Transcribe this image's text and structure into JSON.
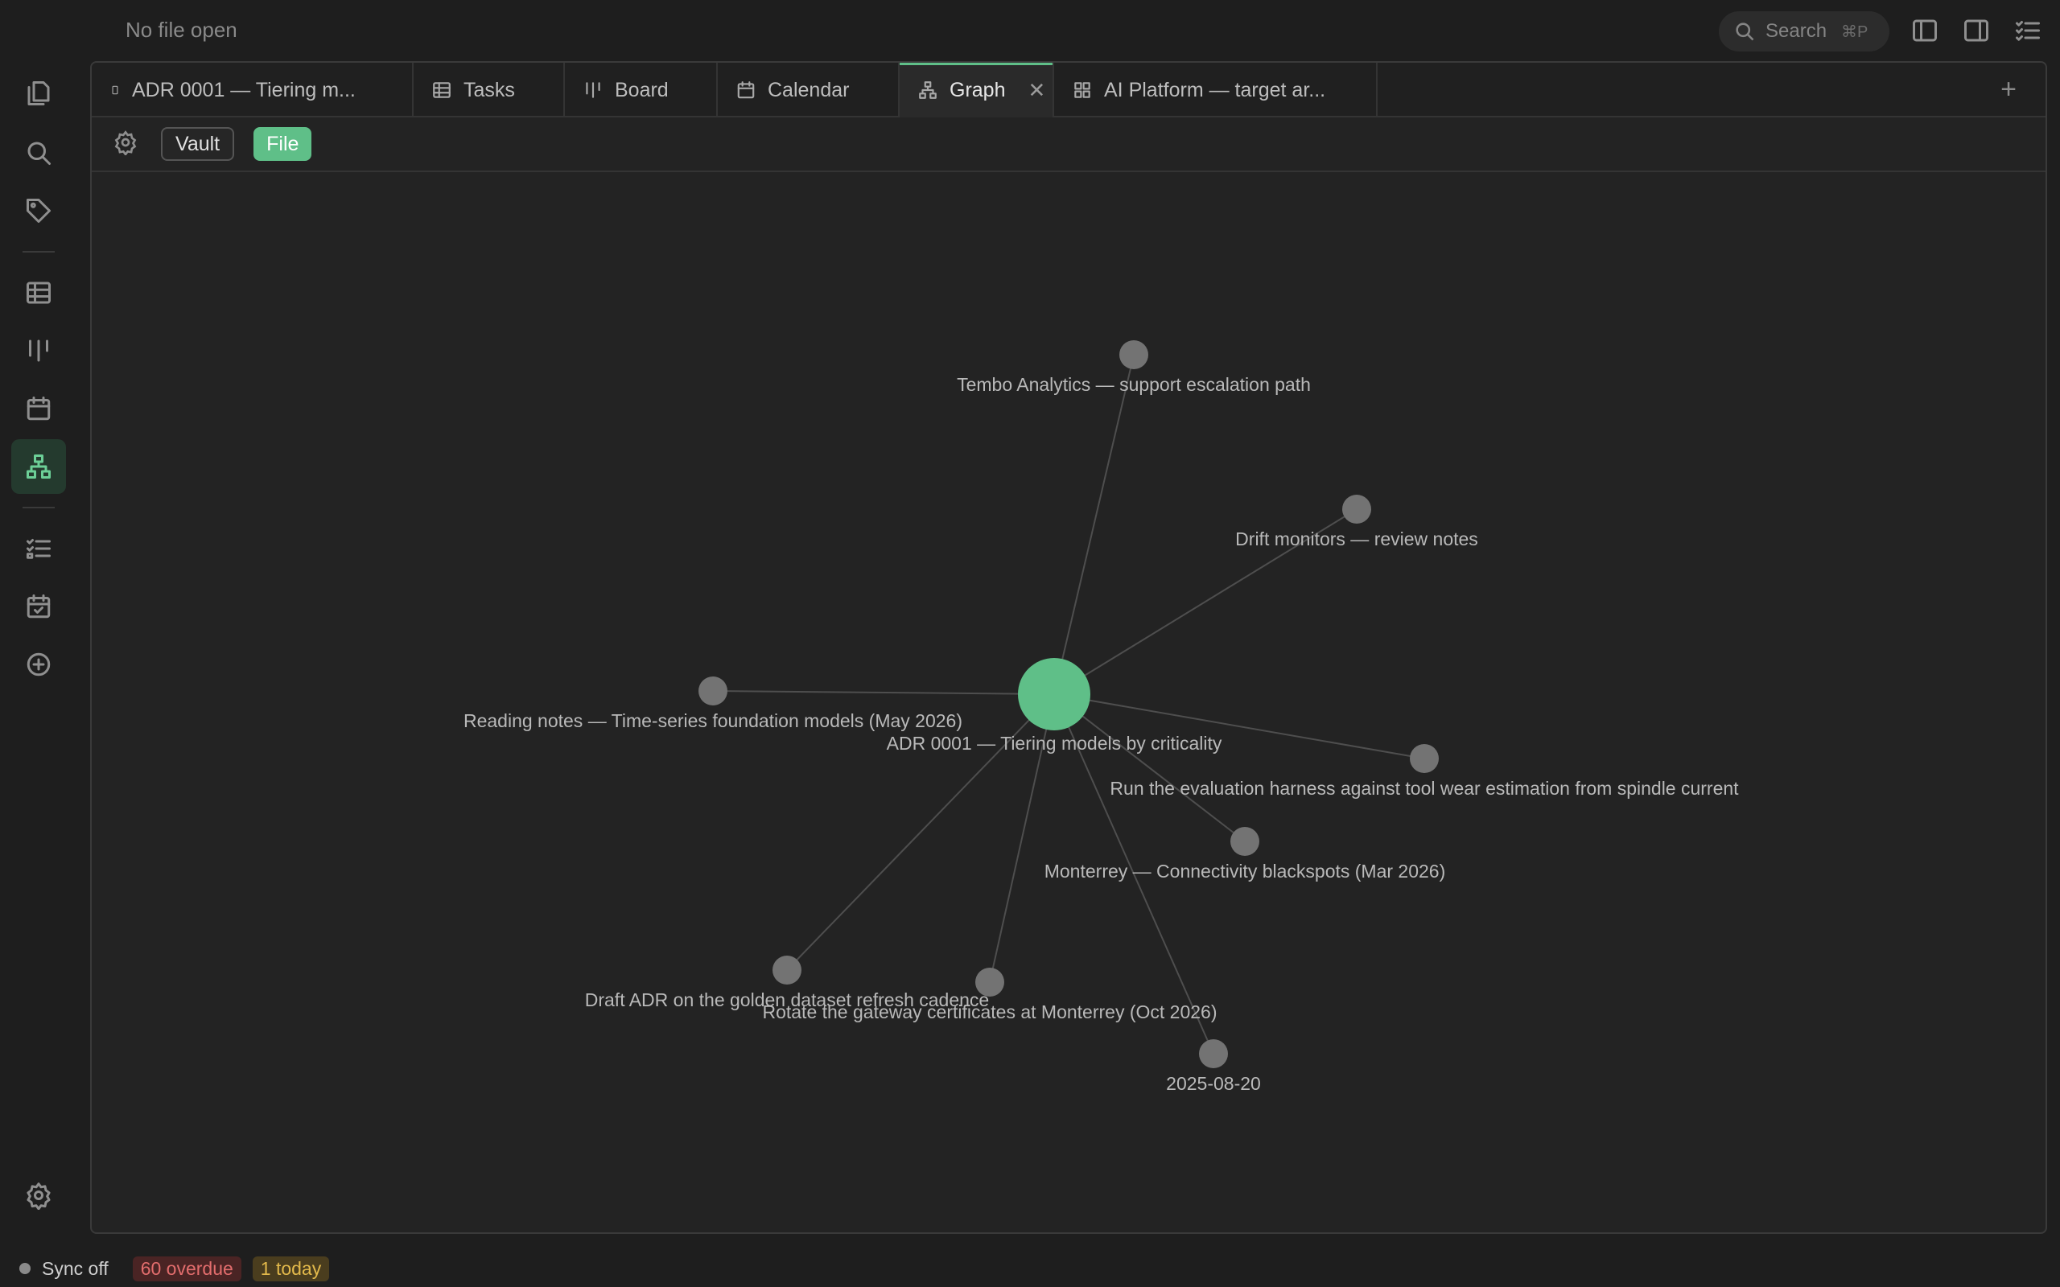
{
  "window": {
    "file_title": "No file open"
  },
  "search": {
    "label": "Search",
    "shortcut": "⌘P"
  },
  "ribbon": {
    "items": [
      {
        "name": "files-icon"
      },
      {
        "name": "search-icon"
      },
      {
        "name": "tags-icon"
      },
      {
        "name": "table-icon"
      },
      {
        "name": "board-icon"
      },
      {
        "name": "calendar-icon"
      },
      {
        "name": "graph-icon",
        "active": true
      },
      {
        "name": "tasks-icon"
      },
      {
        "name": "calendar-check-icon"
      },
      {
        "name": "add-icon"
      },
      {
        "name": "settings-icon"
      }
    ]
  },
  "tabs": [
    {
      "label": "ADR 0001 — Tiering m...",
      "icon": "note-icon"
    },
    {
      "label": "Tasks",
      "icon": "table-icon"
    },
    {
      "label": "Board",
      "icon": "board-icon"
    },
    {
      "label": "Calendar",
      "icon": "calendar-icon"
    },
    {
      "label": "Graph",
      "icon": "graph-icon",
      "active": true
    },
    {
      "label": "AI Platform — target ar...",
      "icon": "grid-icon"
    }
  ],
  "toolbar": {
    "vault_label": "Vault",
    "file_label": "File"
  },
  "graph": {
    "center": {
      "label": "ADR 0001 — Tiering models by criticality",
      "color": "#5fbf88"
    },
    "nodes": [
      {
        "label": "Tembo Analytics — support escalation path"
      },
      {
        "label": "Drift monitors — review notes"
      },
      {
        "label": "Reading notes — Time-series foundation models (May 2026)"
      },
      {
        "label": "Run the evaluation harness against tool wear estimation from spindle current"
      },
      {
        "label": "Monterrey — Connectivity blackspots (Mar 2026)"
      },
      {
        "label": "Draft ADR on the golden dataset refresh cadence"
      },
      {
        "label": "Rotate the gateway certificates at Monterrey (Oct 2026)"
      },
      {
        "label": "2025-08-20"
      }
    ]
  },
  "status": {
    "sync": "Sync off",
    "overdue": "60 overdue",
    "today": "1 today"
  },
  "colors": {
    "accent": "#5fbf88",
    "node": "#737373",
    "overdue": "#e26d6d",
    "today": "#e2b94b"
  }
}
